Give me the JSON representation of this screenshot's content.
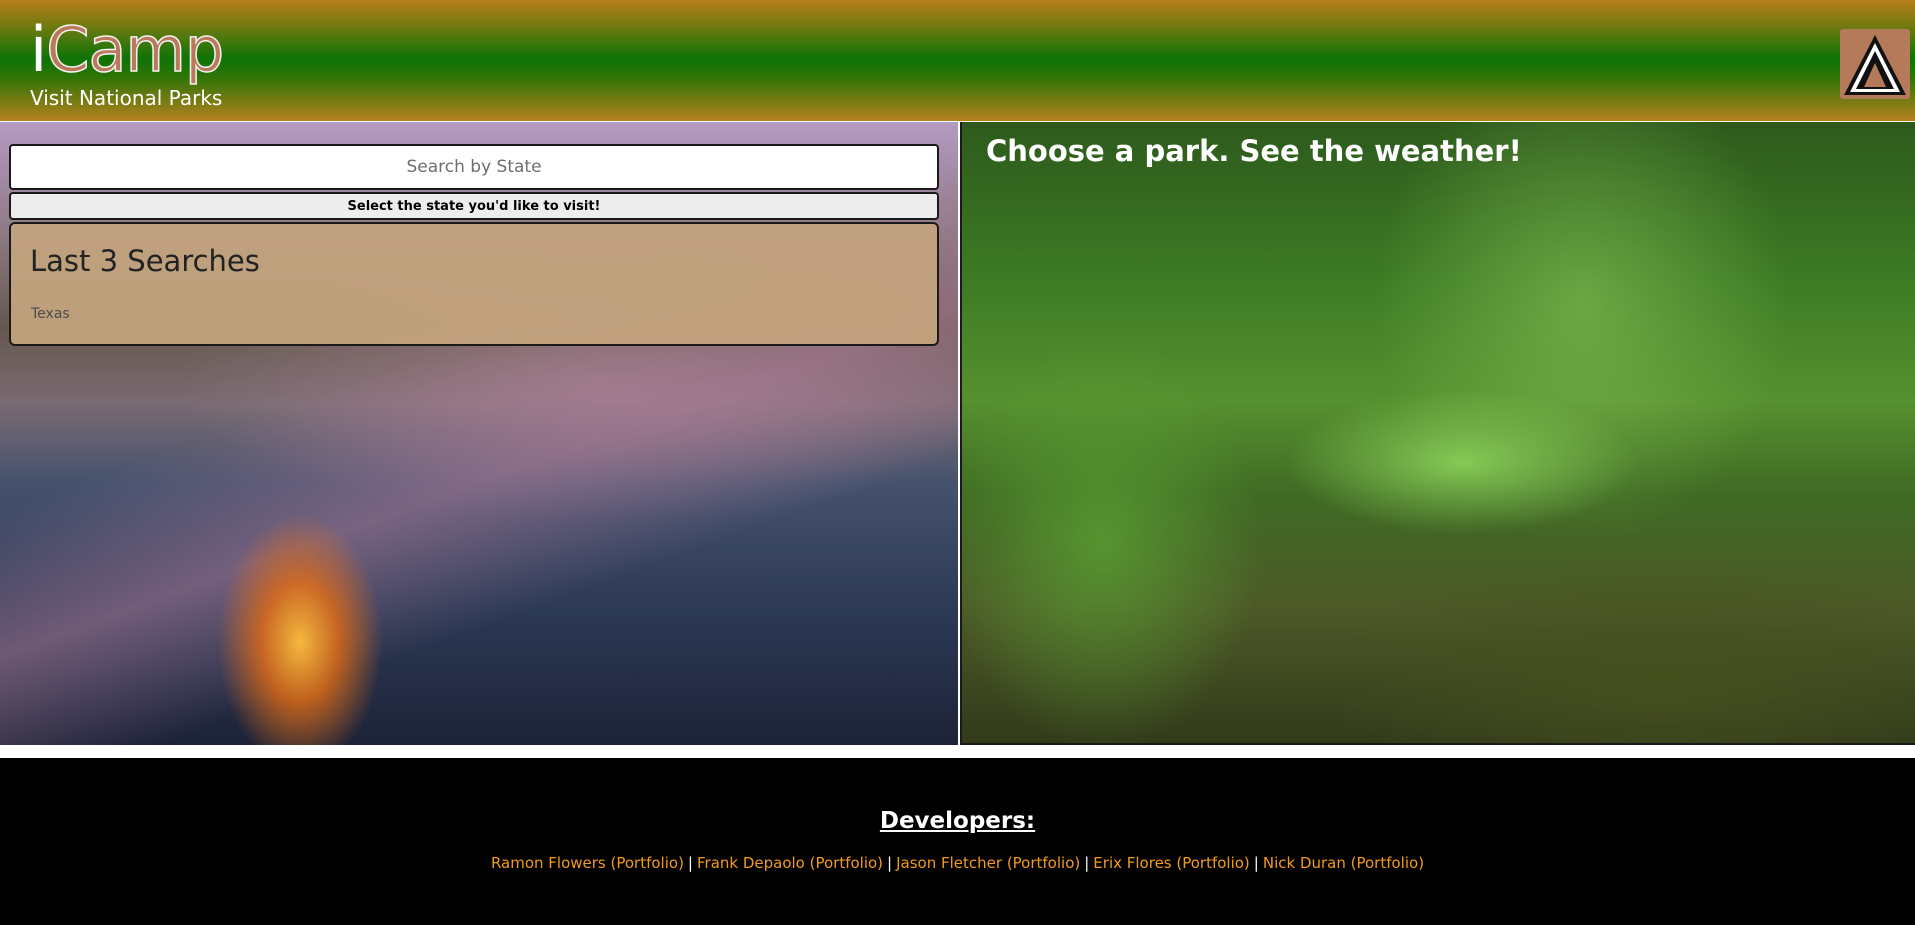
{
  "header": {
    "logo_first": "i",
    "logo_rest": "Camp",
    "tagline": "Visit National Parks",
    "icon": "tent-icon"
  },
  "search": {
    "placeholder": "Search by State",
    "button_label": "Select the state you'd like to visit!"
  },
  "history": {
    "title": "Last 3 Searches",
    "items": [
      "Texas"
    ]
  },
  "main": {
    "heading": "Choose a park. See the weather!"
  },
  "footer": {
    "title": "Developers:",
    "developers": [
      "Ramon Flowers (Portfolio)",
      "Frank Depaolo (Portfolio)",
      "Jason Fletcher (Portfolio)",
      "Erix Flores (Portfolio)",
      "Nick Duran (Portfolio)"
    ],
    "separator": "|"
  },
  "colors": {
    "accent_link": "#f39a1e",
    "card_bg": "#c4a47e",
    "header_green": "#0f7306",
    "header_gold": "#b97d1c"
  }
}
